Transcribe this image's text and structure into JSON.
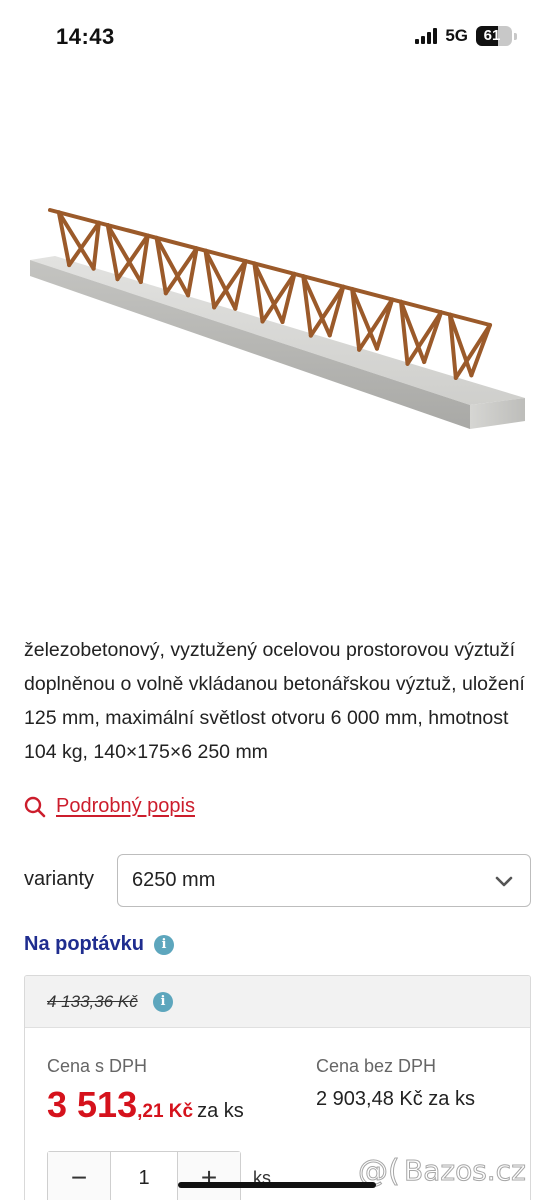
{
  "status_bar": {
    "time": "14:43",
    "network": "5G",
    "battery": "61",
    "battery_level": 0.61
  },
  "product": {
    "image_icon": "concrete-lintel-truss-image",
    "description": "železobetonový, vyztužený ocelovou prostorovou výztuží doplněnou o volně vkládanou betonářskou výztuž, uložení 125 mm, maximální světlost otvoru 6 000 mm, hmotnost 104 kg, 140×175×6 250 mm"
  },
  "detail_link": {
    "label": "Podrobný popis",
    "icon": "search-icon"
  },
  "variants": {
    "label": "varianty",
    "selected": "6250 mm"
  },
  "availability": {
    "label": "Na poptávku",
    "icon": "info-icon"
  },
  "price": {
    "old_price": "4 133,36 Kč",
    "with_vat_label": "Cena s DPH",
    "with_vat_int": "3 513",
    "with_vat_dec": ",21 Kč",
    "per_unit": "za ks",
    "without_vat_label": "Cena bez DPH",
    "without_vat": "2 903,48 Kč za ks",
    "quantity": "1",
    "unit": "ks",
    "minus": "−",
    "plus": "+"
  },
  "watermark": {
    "text": "Bazos.cz"
  },
  "colors": {
    "accent_red": "#d5121c",
    "link_red": "#cc1d2c",
    "navy": "#1f2d8f",
    "info_teal": "#5da6bd"
  }
}
